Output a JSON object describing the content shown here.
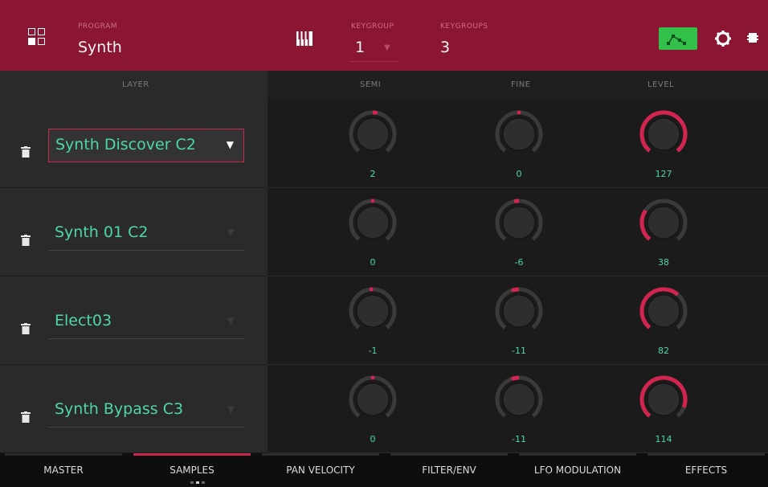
{
  "header": {
    "program_label": "PROGRAM",
    "program_value": "Synth",
    "keygroup_label": "KEYGROUP",
    "keygroup_value": "1",
    "keygroups_label": "KEYGROUPS",
    "keygroups_value": "3",
    "icons": [
      "grid-menu-icon",
      "keyboard-icon",
      "envelope-icon",
      "gear-icon",
      "stop-icon"
    ]
  },
  "columns": {
    "layer": "LAYER",
    "semi": "SEMI",
    "fine": "FINE",
    "level": "LEVEL"
  },
  "layers": [
    {
      "sample": "Synth Discover C2",
      "semi": "2",
      "fine": "0",
      "level": "127"
    },
    {
      "sample": "Synth 01 C2",
      "semi": "0",
      "fine": "-6",
      "level": "38"
    },
    {
      "sample": "Elect03",
      "semi": "-1",
      "fine": "-11",
      "level": "82"
    },
    {
      "sample": "Synth Bypass C3",
      "semi": "0",
      "fine": "-11",
      "level": "114"
    }
  ],
  "tabs": [
    "MASTER",
    "SAMPLES",
    "PAN VELOCITY",
    "FILTER/ENV",
    "LFO MODULATION",
    "EFFECTS"
  ],
  "active_tab": "SAMPLES",
  "colors": {
    "accent": "#c7284c",
    "value_text": "#4fd6a7",
    "header_bg": "#8a1633",
    "env_button": "#33c04a"
  }
}
